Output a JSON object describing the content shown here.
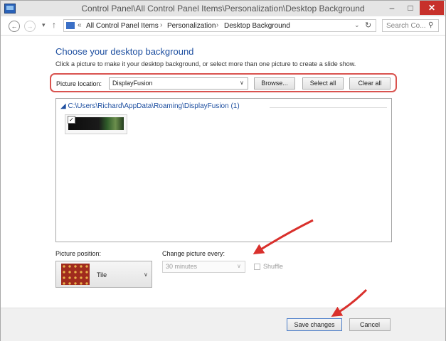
{
  "window": {
    "title": "Control Panel\\All Control Panel Items\\Personalization\\Desktop Background",
    "minimize": "–",
    "maximize": "□",
    "close": "✕"
  },
  "nav": {
    "back": "←",
    "forward": "→",
    "recent": "▾",
    "up": "↑",
    "breadcrumb_prefix": "«",
    "crumbs": [
      "All Control Panel Items",
      "Personalization",
      "Desktop Background"
    ],
    "separator": "›",
    "dropdown": "⌄",
    "refresh": "↻",
    "search_placeholder": "Search Co...",
    "search_icon": "⚲"
  },
  "main": {
    "heading": "Choose your desktop background",
    "subtext": "Click a picture to make it your desktop background, or select more than one picture to create a slide show.",
    "picture_location_label": "Picture location:",
    "picture_location_value": "DisplayFusion",
    "browse_label": "Browse...",
    "select_all_label": "Select all",
    "clear_all_label": "Clear all",
    "group_header": "◢ C:\\Users\\Richard\\AppData\\Roaming\\DisplayFusion (1)",
    "thumbnail_checked": "✓"
  },
  "options": {
    "picture_position_label": "Picture position:",
    "picture_position_value": "Tile",
    "change_picture_label": "Change picture every:",
    "change_picture_value": "30 minutes",
    "shuffle_label": "Shuffle"
  },
  "footer": {
    "save_label": "Save changes",
    "cancel_label": "Cancel"
  },
  "colors": {
    "heading": "#1e4fa0",
    "highlight": "#d9534f",
    "annotation_arrow": "#d9302c",
    "close_button": "#c7312b"
  }
}
